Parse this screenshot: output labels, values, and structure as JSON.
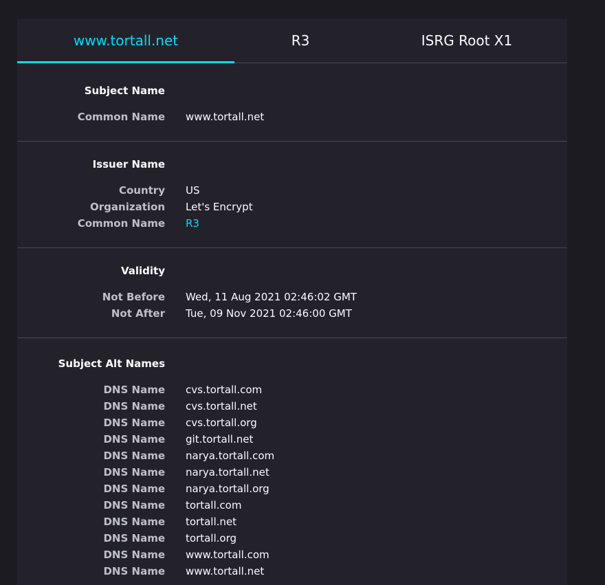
{
  "tabs": [
    {
      "label": "www.tortall.net",
      "active": true
    },
    {
      "label": "R3",
      "active": false
    },
    {
      "label": "ISRG Root X1",
      "active": false
    }
  ],
  "sections": {
    "subject": {
      "title": "Subject Name",
      "rows": [
        {
          "label": "Common Name",
          "value": "www.tortall.net"
        }
      ]
    },
    "issuer": {
      "title": "Issuer Name",
      "rows": [
        {
          "label": "Country",
          "value": "US"
        },
        {
          "label": "Organization",
          "value": "Let's Encrypt"
        },
        {
          "label": "Common Name",
          "value": "R3"
        }
      ]
    },
    "validity": {
      "title": "Validity",
      "rows": [
        {
          "label": "Not Before",
          "value": "Wed, 11 Aug 2021 02:46:02 GMT"
        },
        {
          "label": "Not After",
          "value": "Tue, 09 Nov 2021 02:46:00 GMT"
        }
      ]
    },
    "san": {
      "title": "Subject Alt Names",
      "rows": [
        {
          "label": "DNS Name",
          "value": "cvs.tortall.com"
        },
        {
          "label": "DNS Name",
          "value": "cvs.tortall.net"
        },
        {
          "label": "DNS Name",
          "value": "cvs.tortall.org"
        },
        {
          "label": "DNS Name",
          "value": "git.tortall.net"
        },
        {
          "label": "DNS Name",
          "value": "narya.tortall.com"
        },
        {
          "label": "DNS Name",
          "value": "narya.tortall.net"
        },
        {
          "label": "DNS Name",
          "value": "narya.tortall.org"
        },
        {
          "label": "DNS Name",
          "value": "tortall.com"
        },
        {
          "label": "DNS Name",
          "value": "tortall.net"
        },
        {
          "label": "DNS Name",
          "value": "tortall.org"
        },
        {
          "label": "DNS Name",
          "value": "www.tortall.com"
        },
        {
          "label": "DNS Name",
          "value": "www.tortall.net"
        }
      ]
    }
  },
  "colors": {
    "accent": "#00ddff",
    "background": "#1c1b22",
    "panel": "#23222b",
    "divider": "#4a4953"
  }
}
